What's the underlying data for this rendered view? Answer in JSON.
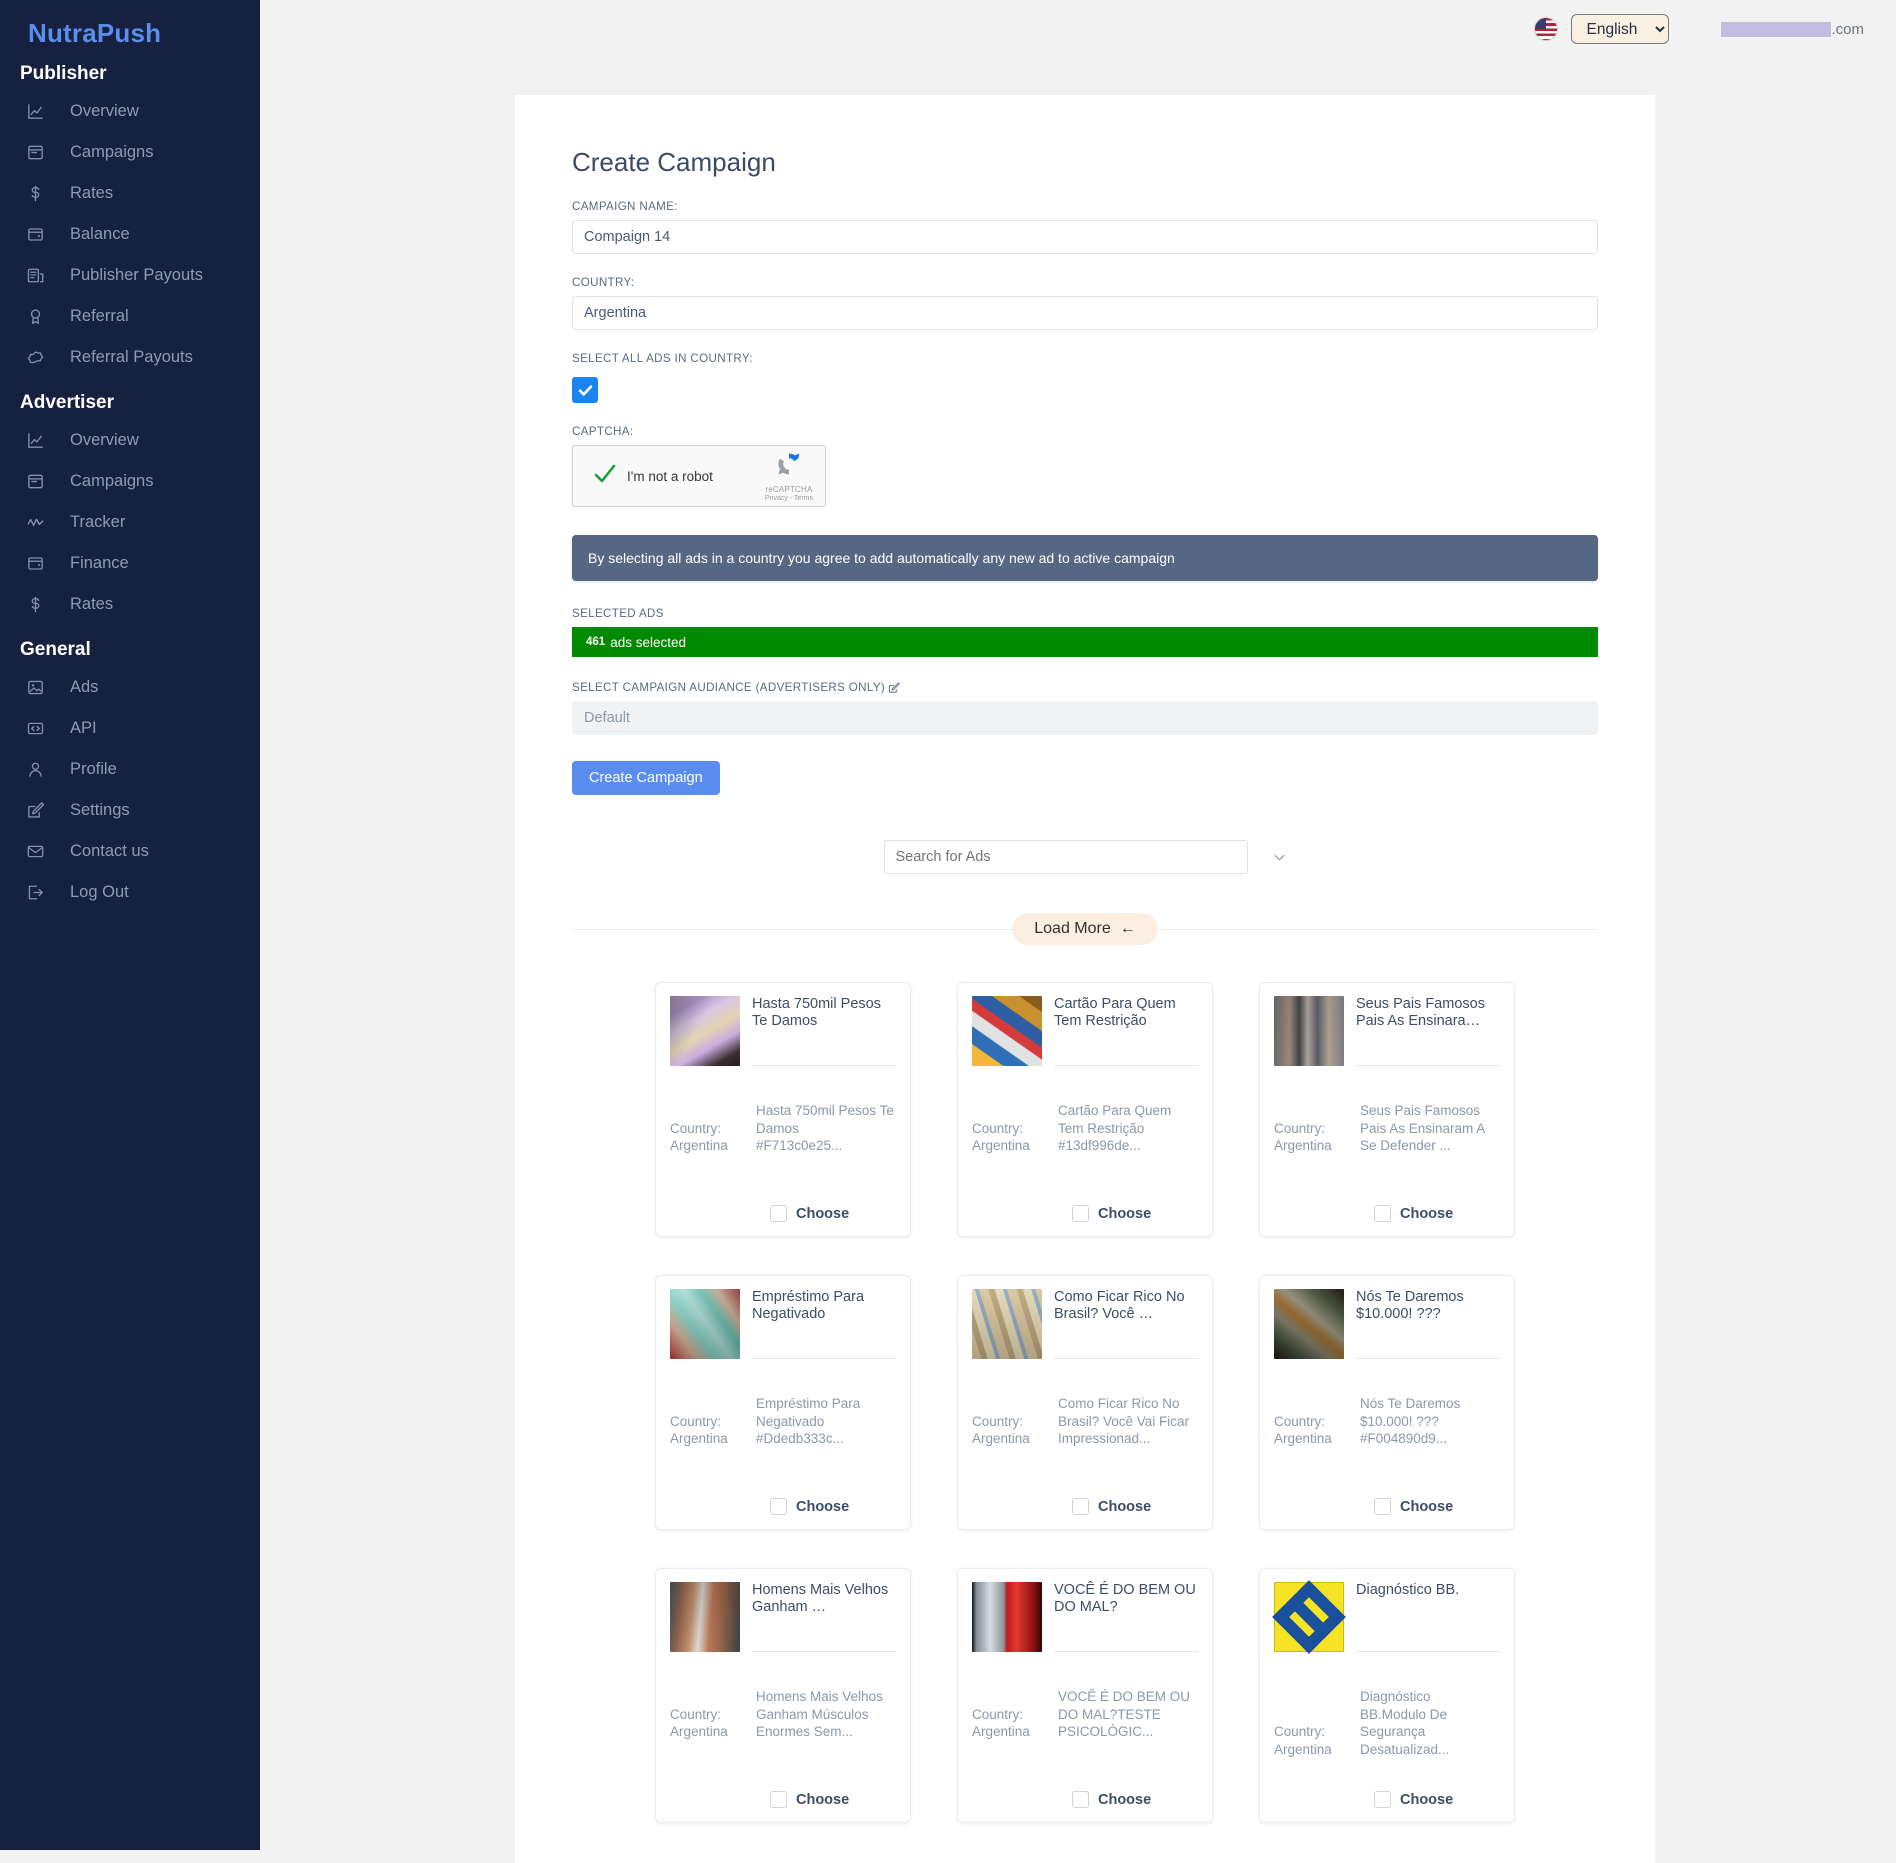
{
  "brand": "NutraPush",
  "sidebar": {
    "groups": [
      {
        "title": "Publisher",
        "items": [
          {
            "label": "Overview",
            "icon": "chart-line-icon"
          },
          {
            "label": "Campaigns",
            "icon": "browser-icon"
          },
          {
            "label": "Rates",
            "icon": "dollar-icon"
          },
          {
            "label": "Balance",
            "icon": "wallet-icon"
          },
          {
            "label": "Publisher Payouts",
            "icon": "report-icon"
          },
          {
            "label": "Referral",
            "icon": "medal-icon"
          },
          {
            "label": "Referral Payouts",
            "icon": "badge-icon"
          }
        ]
      },
      {
        "title": "Advertiser",
        "items": [
          {
            "label": "Overview",
            "icon": "chart-line-icon"
          },
          {
            "label": "Campaigns",
            "icon": "browser-icon"
          },
          {
            "label": "Tracker",
            "icon": "pulse-icon"
          },
          {
            "label": "Finance",
            "icon": "wallet-icon"
          },
          {
            "label": "Rates",
            "icon": "dollar-icon"
          }
        ]
      },
      {
        "title": "General",
        "items": [
          {
            "label": "Ads",
            "icon": "image-icon"
          },
          {
            "label": "API",
            "icon": "code-icon"
          },
          {
            "label": "Profile",
            "icon": "user-icon"
          },
          {
            "label": "Settings",
            "icon": "pencil-square-icon"
          },
          {
            "label": "Contact us",
            "icon": "envelope-icon"
          },
          {
            "label": "Log Out",
            "icon": "logout-icon"
          }
        ]
      }
    ]
  },
  "topbar": {
    "flag": "us-flag-icon",
    "language": "English",
    "language_options": [
      "English"
    ],
    "email_suffix": ".com"
  },
  "form": {
    "title": "Create Campaign",
    "campaign_name_label": "CAMPAIGN NAME:",
    "campaign_name_value": "Compaign 14",
    "country_label": "COUNTRY:",
    "country_value": "Argentina",
    "select_all_label": "SELECT ALL ADS IN COUNTRY:",
    "select_all_checked": true,
    "captcha_label": "CAPTCHA:",
    "captcha": {
      "text": "I'm not a robot",
      "brand": "reCAPTCHA",
      "terms": "Privacy - Terms",
      "checked": true
    },
    "info_banner": "By selecting all ads in a country you agree to add automatically any new ad to active campaign",
    "selected_ads_label": "SELECTED ADS",
    "selected_count": "461",
    "selected_suffix": "ads selected",
    "audience_label": "SELECT CAMPAIGN AUDIANCE (ADVERTISERS ONLY)",
    "audience_edit_icon": "pencil-square-icon",
    "audience_value": "Default",
    "create_button": "Create Campaign"
  },
  "search": {
    "placeholder": "Search for Ads",
    "value": "",
    "caret_icon": "chevron-down-icon"
  },
  "load_more": {
    "label": "Load More",
    "arrow": "←"
  },
  "ads": {
    "country_label": "Country:",
    "choose_label": "Choose",
    "items": [
      {
        "title": "Hasta 750mil Pesos Te Damos",
        "country": "Argentina",
        "description": "Hasta 750mil Pesos Te Damos",
        "hash": "#F713c0e25...",
        "thumb": "th-money-ar"
      },
      {
        "title": "Cartão Para Quem Tem Restrição",
        "country": "Argentina",
        "description": "Cartão Para Quem Tem Restrição",
        "hash": "#13df996de...",
        "thumb": "th-cards"
      },
      {
        "title": "Seus Pais Famosos Pais As Ensinara…",
        "country": "Argentina",
        "description": "Seus Pais Famosos Pais As Ensinaram A Se Defender ...",
        "hash": "",
        "thumb": "th-boxers"
      },
      {
        "title": "Empréstimo Para Negativado",
        "country": "Argentina",
        "description": "Empréstimo Para Negativado",
        "hash": "#Ddedb333c...",
        "thumb": "th-hand-money"
      },
      {
        "title": "Como Ficar Rico No Brasil? Você …",
        "country": "Argentina",
        "description": "Como Ficar Rico No Brasil? Você Vai Ficar Impressionad...",
        "hash": "",
        "thumb": "th-stacks"
      },
      {
        "title": "Nós Te Daremos $10.000! ???",
        "country": "Argentina",
        "description": "Nós Te Daremos $10.000! ???",
        "hash": "#F004890d9...",
        "thumb": "th-dollars"
      },
      {
        "title": "Homens Mais Velhos Ganham …",
        "country": "Argentina",
        "description": "Homens Mais Velhos Ganham Músculos Enormes Sem...",
        "hash": "",
        "thumb": "th-bodybuilder"
      },
      {
        "title": "VOCÊ É DO BEM OU DO MAL?",
        "country": "Argentina",
        "description": "VOCÊ É DO BEM OU DO MAL?TESTE PSICOLÓGIC...",
        "hash": "",
        "thumb": "th-face"
      },
      {
        "title": "Diagnóstico BB.",
        "country": "Argentina",
        "description": "Diagnóstico BB.Modulo De Segurança Desatualizad...",
        "hash": "",
        "thumb": "th-bb-logo"
      }
    ]
  },
  "colors": {
    "sidebar_bg": "#16213f",
    "brand": "#5b8def",
    "accent_blue": "#5b8def",
    "checkbox_blue": "#1a85f0",
    "banner_slate": "#556782",
    "success_green": "#008a00",
    "load_more_bg": "#fdeee2"
  }
}
